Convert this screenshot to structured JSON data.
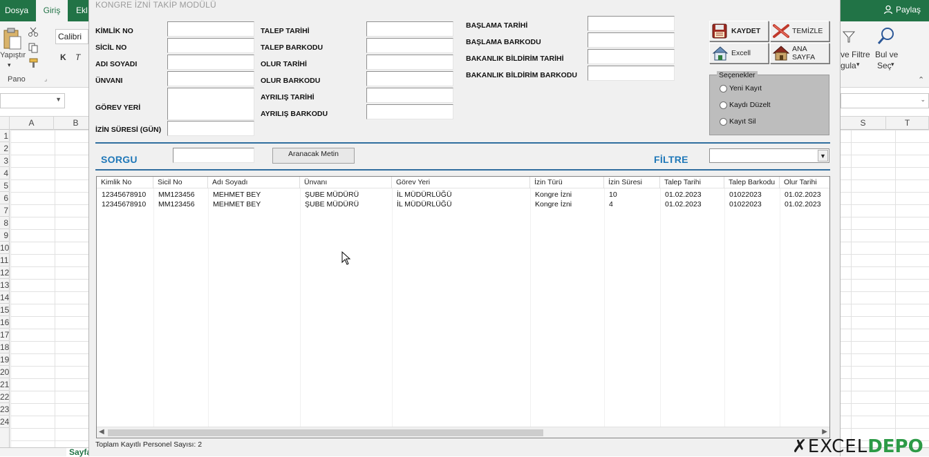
{
  "excel": {
    "tabs": [
      "Dosya",
      "Giriş",
      "Ekl"
    ],
    "share": "Paylaş",
    "clipboard": {
      "paste": "Yapıştır",
      "group": "Pano"
    },
    "font": {
      "name": "Calibri",
      "bold": "K",
      "italic": "T"
    },
    "right_group": {
      "sort_filter_1": "ve Filtre",
      "sort_filter_2": "gula",
      "find_1": "Bul ve",
      "find_2": "Seç"
    },
    "columns_left": [
      "A",
      "B"
    ],
    "columns_right": [
      "S",
      "T"
    ],
    "rows": [
      "1",
      "2",
      "3",
      "4",
      "5",
      "6",
      "7",
      "8",
      "9",
      "10",
      "11",
      "12",
      "13",
      "14",
      "15",
      "16",
      "17",
      "18",
      "19",
      "20",
      "21",
      "22",
      "23",
      "24"
    ],
    "sheet_tab": "Sayfa"
  },
  "form": {
    "title": "KONGRE İZNİ TAKİP MODÜLÜ",
    "labels": {
      "kimlik_no": "KİMLİK NO",
      "sicil_no": "SİCİL NO",
      "adi_soyadi": "ADI SOYADI",
      "unvani": "ÜNVANI",
      "gorev_yeri": "GÖREV YERİ",
      "izin_suresi": "İZİN SÜRESİ (GÜN)",
      "talep_tarihi": "TALEP TARİHİ",
      "talep_barkodu": "TALEP BARKODU",
      "olur_tarihi": "OLUR TARİHİ",
      "olur_barkodu": "OLUR BARKODU",
      "ayrilis_tarihi": "AYRILIŞ TARİHİ",
      "ayrilis_barkodu": "AYRILIŞ BARKODU",
      "baslama_tarihi": "BAŞLAMA TARİHİ",
      "baslama_barkodu": "BAŞLAMA BARKODU",
      "bakanlik_bildirim_tarihi": "BAKANLIK BİLDİRİM TARİHİ",
      "bakanlik_bildirim_barkodu": "BAKANLIK BİLDİRİM BARKODU"
    },
    "buttons": {
      "kaydet": "KAYDET",
      "temizle": "TEMİZLE",
      "excel": "Excell",
      "ana_sayfa": "ANA SAYFA"
    },
    "options": {
      "caption": "Seçenekler",
      "items": [
        "Yeni Kayıt",
        "Kaydı Düzelt",
        "Kayıt Sil"
      ]
    },
    "sorgu": "SORGU",
    "aranacak": "Aranacak Metin",
    "filtre": "FİLTRE",
    "list": {
      "columns": [
        "Kimlik No",
        "Sicil No",
        "Adı Soyadı",
        "Ünvanı",
        "Görev Yeri",
        "İzin Türü",
        "İzin Süresi",
        "Talep Tarihi",
        "Talep Barkodu",
        "Olur Tarihi"
      ],
      "rows": [
        [
          "12345678910",
          "MM123456",
          "MEHMET BEY",
          "ŞUBE MÜDÜRÜ",
          "İL MÜDÜRLÜĞÜ",
          "Kongre İzni",
          "10",
          "01.02.2023",
          "01022023",
          "01.02.2023"
        ],
        [
          "12345678910",
          "MM123456",
          "MEHMET BEY",
          "ŞUBE MÜDÜRÜ",
          "İL MÜDÜRLÜĞÜ",
          "Kongre İzni",
          "4",
          "01.02.2023",
          "01022023",
          "01.02.2023"
        ]
      ]
    },
    "total": "Toplam Kayıtlı Personel Sayısı: 2"
  },
  "watermark": {
    "excel": "EXCEL",
    "depo": "DEPO"
  }
}
